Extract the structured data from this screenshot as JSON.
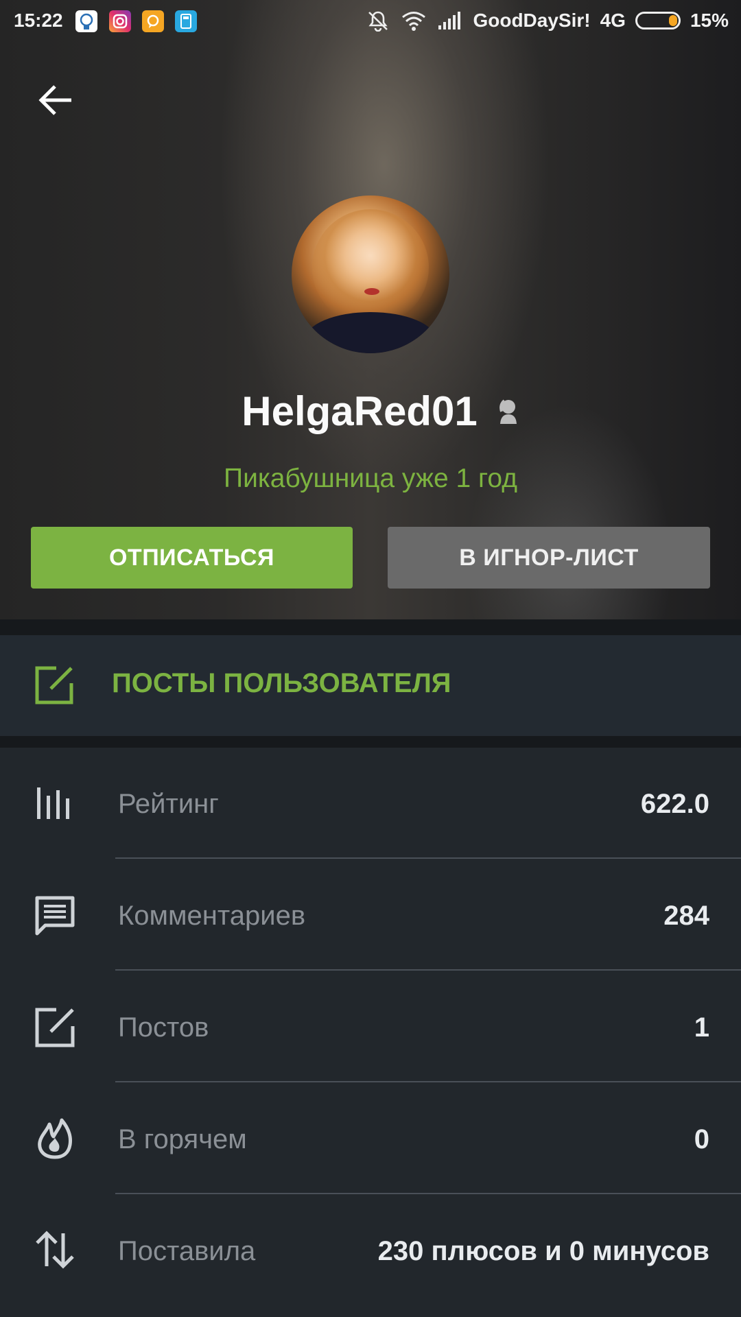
{
  "status_bar": {
    "time": "15:22",
    "carrier": "GoodDaySir!",
    "network": "4G",
    "battery": "15%",
    "battery_level": 0.15,
    "app_icons": [
      "app-icon-1",
      "instagram-icon",
      "chat-bubble-app-icon",
      "calculator-app-icon"
    ],
    "app_colors": [
      "#ffffff",
      "#e1306c",
      "#f5a623",
      "#29a8e0"
    ]
  },
  "profile": {
    "username": "HelgaRed01",
    "membership": "Пикабушница уже 1 год"
  },
  "actions": {
    "unsubscribe": "ОТПИСАТЬСЯ",
    "ignore": "В ИГНОР-ЛИСТ"
  },
  "posts_link": {
    "label": "ПОСТЫ ПОЛЬЗОВАТЕЛЯ"
  },
  "stats": [
    {
      "label": "Рейтинг",
      "value": "622.0",
      "icon": "bar-chart-icon"
    },
    {
      "label": "Комментариев",
      "value": "284",
      "icon": "comment-icon"
    },
    {
      "label": "Постов",
      "value": "1",
      "icon": "edit-icon"
    },
    {
      "label": "В горячем",
      "value": "0",
      "icon": "flame-icon"
    },
    {
      "label": "Поставила",
      "value": "230 плюсов и 0 минусов",
      "icon": "up-down-arrows-icon"
    }
  ],
  "colors": {
    "accent_green": "#7cb342",
    "ignore_gray": "#6a6a6a",
    "background": "#22272c"
  }
}
